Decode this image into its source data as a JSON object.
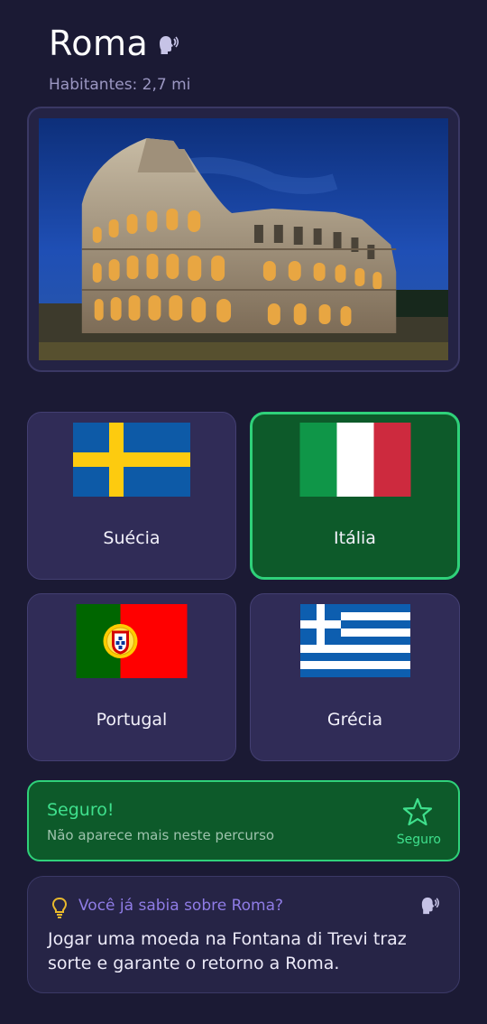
{
  "header": {
    "city": "Roma",
    "population": "Habitantes: 2,7 mi",
    "speak_icon": "speaking-head-icon"
  },
  "image": {
    "subject": "Coliseu de Roma à noite"
  },
  "options": [
    {
      "label": "Suécia",
      "flag": "sweden",
      "selected": false
    },
    {
      "label": "Itália",
      "flag": "italy",
      "selected": true
    },
    {
      "label": "Portugal",
      "flag": "portugal",
      "selected": false
    },
    {
      "label": "Grécia",
      "flag": "greece",
      "selected": false
    }
  ],
  "feedback": {
    "title": "Seguro!",
    "subtitle": "Não aparece mais neste percurso",
    "star_label": "Seguro",
    "icon": "star-icon"
  },
  "fact": {
    "title": "Você já sabia sobre Roma?",
    "text": "Jogar uma moeda na Fontana di Trevi traz sorte e garante o retorno a Roma.",
    "icon": "lightbulb-icon"
  },
  "colors": {
    "background": "#1b1a34",
    "card": "#302c57",
    "correct_bg": "#0d5a2a",
    "correct_border": "#2fd17a",
    "accent_purple": "#8f7ce6"
  }
}
